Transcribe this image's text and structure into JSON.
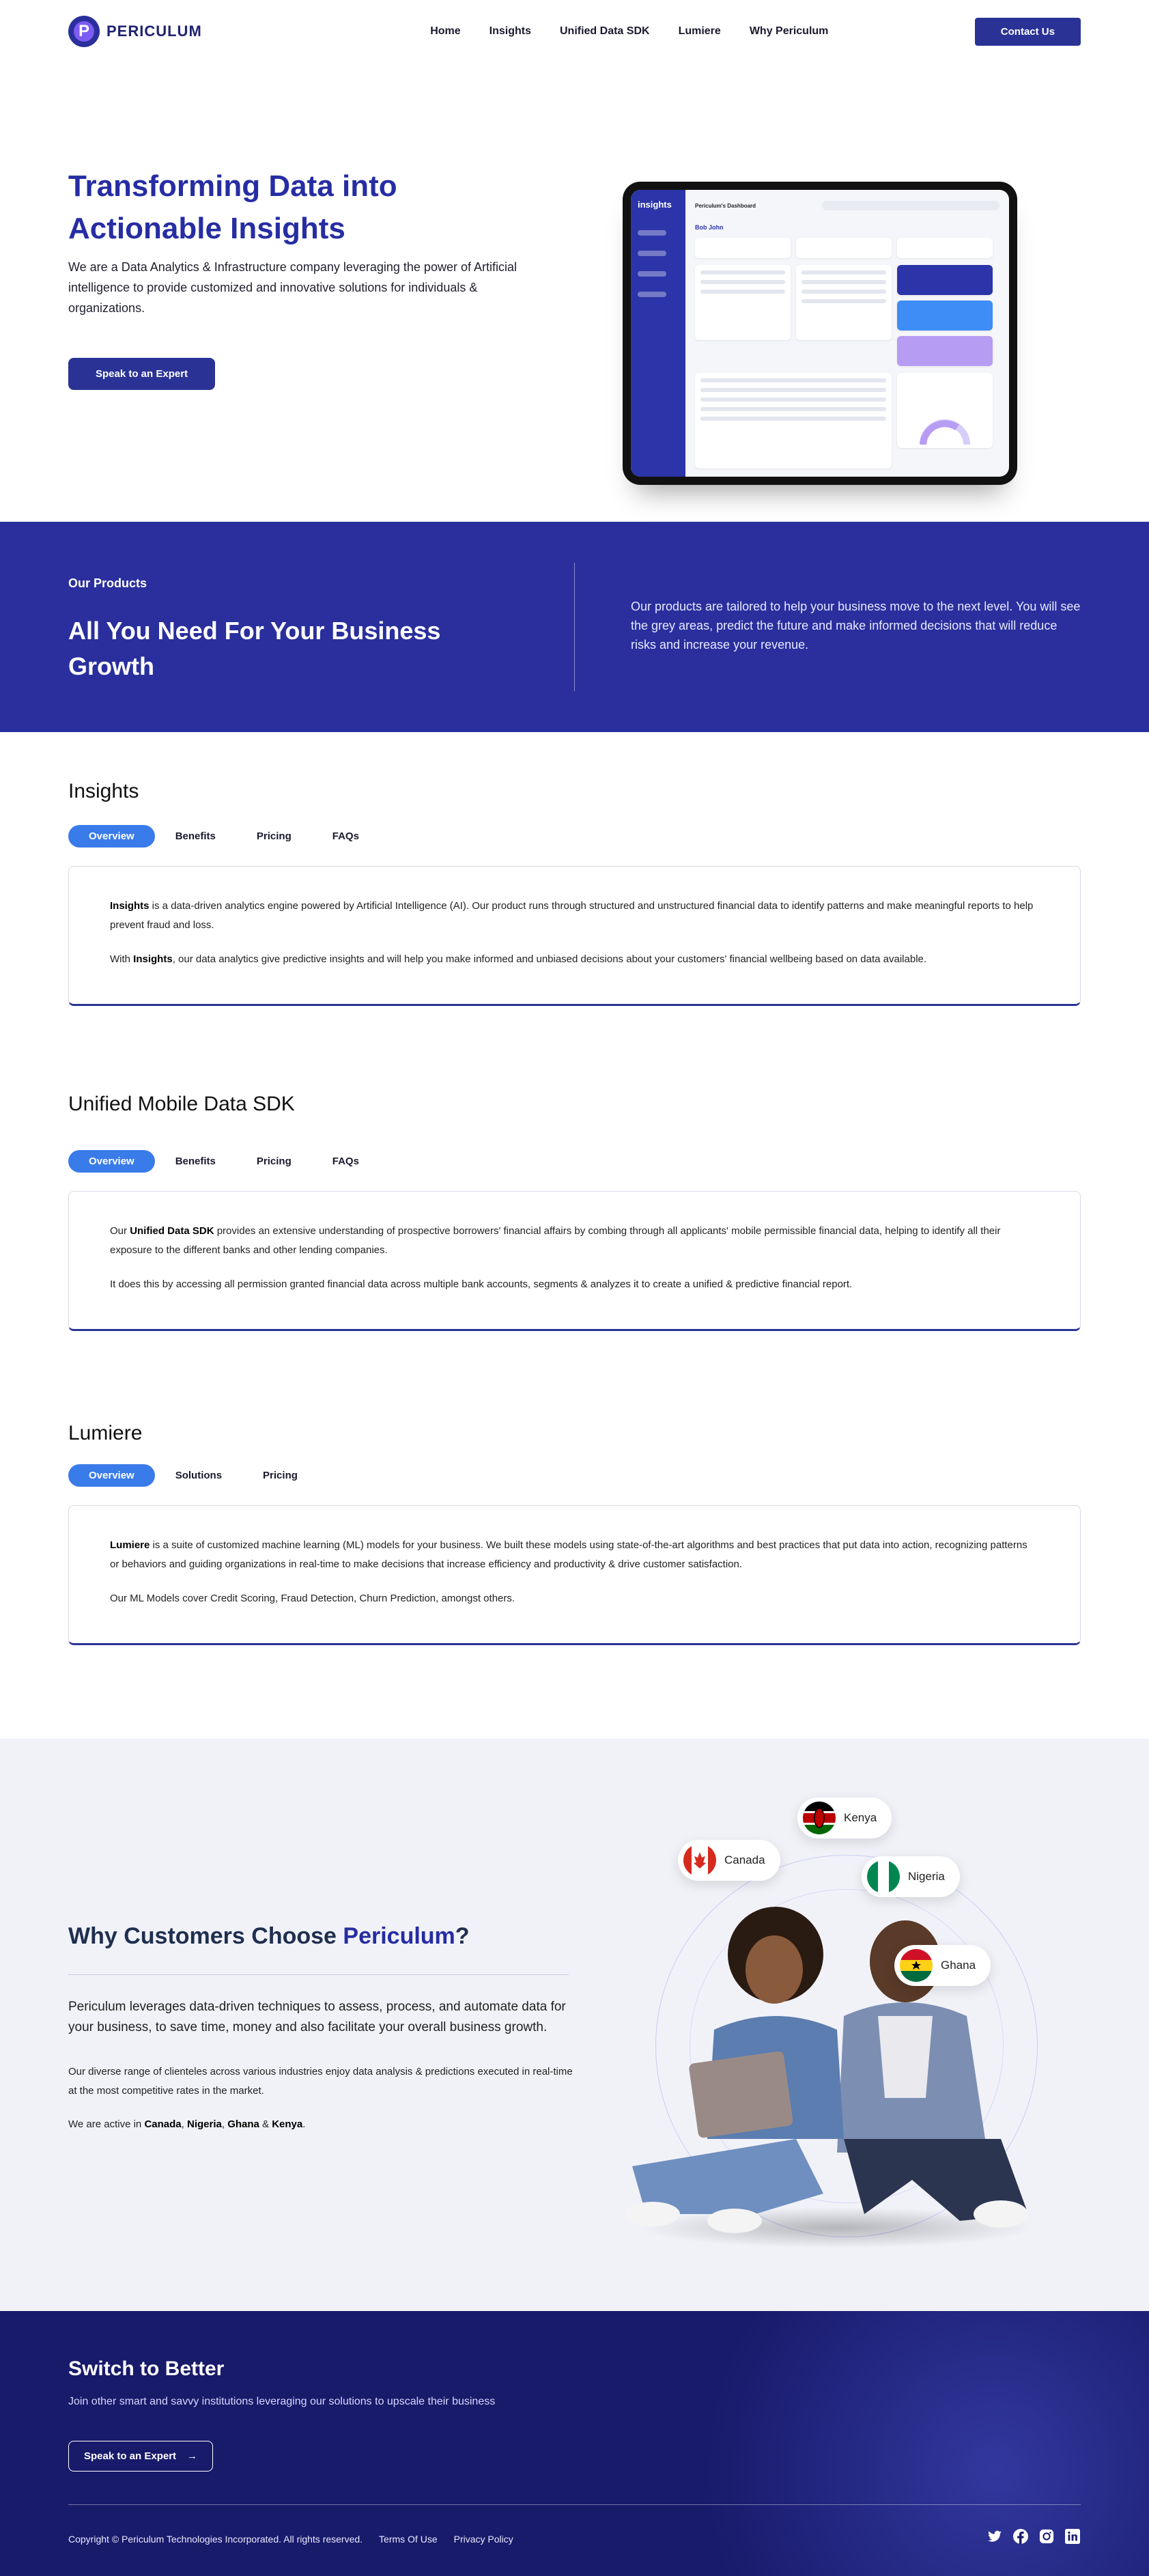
{
  "nav": {
    "logo_text": "PERICULUM",
    "links": [
      "Home",
      "Insights",
      "Unified Data SDK",
      "Lumiere",
      "Why Periculum"
    ],
    "contact_label": "Contact Us"
  },
  "hero": {
    "title": "Transforming Data into Actionable Insights",
    "subtitle": "We are a Data Analytics & Infrastructure company leveraging the power of Artificial intelligence to provide customized and innovative solutions for individuals & organizations.",
    "cta": "Speak to an Expert",
    "tablet": {
      "brand": "insights",
      "dashboard_title": "Periculum's Dashboard",
      "greeting": "Bob John"
    }
  },
  "products": {
    "label": "Our Products",
    "title": "All You Need For Your Business Growth",
    "description": "Our products are tailored to help your business move to the next level. You will see the grey areas, predict the future and make informed decisions that will reduce risks and increase your revenue."
  },
  "insights": {
    "title": "Insights",
    "tabs": [
      "Overview",
      "Benefits",
      "Pricing",
      "FAQs"
    ],
    "p1_strong": "Insights",
    "p1_rest": " is a data-driven analytics engine powered by Artificial Intelligence (AI). Our product runs through structured and unstructured financial data to identify patterns and make meaningful reports to help prevent fraud and loss.",
    "p2_pre": "With ",
    "p2_strong": "Insights",
    "p2_rest": ", our data analytics give predictive insights and will help you make informed and unbiased decisions about your customers' financial wellbeing based on data available."
  },
  "sdk": {
    "title": "Unified Mobile Data SDK",
    "tabs": [
      "Overview",
      "Benefits",
      "Pricing",
      "FAQs"
    ],
    "p1_pre": "Our ",
    "p1_strong": "Unified Data SDK",
    "p1_rest": " provides an extensive understanding of prospective borrowers' financial affairs by combing through all applicants' mobile permissible financial data, helping to identify all their exposure to the different banks and other lending companies.",
    "p2": "It does this by accessing all permission granted financial data across multiple bank accounts, segments & analyzes it to create a unified & predictive financial report."
  },
  "lumiere": {
    "title": "Lumiere",
    "tabs": [
      "Overview",
      "Solutions",
      "Pricing"
    ],
    "p1_strong": "Lumiere",
    "p1_rest": " is a suite of customized machine learning (ML) models for your business. We built these models using state-of-the-art algorithms and best practices that put data into action, recognizing patterns or behaviors and guiding organizations in real-time to make decisions that increase efficiency and productivity & drive customer satisfaction.",
    "p2": "Our ML Models cover Credit Scoring, Fraud Detection, Churn Prediction, amongst others."
  },
  "why": {
    "title_pre": "Why Customers Choose ",
    "title_accent": "Periculum",
    "title_post": "?",
    "p1": "Periculum leverages data-driven techniques to assess, process, and automate data for your business, to save time, money and also facilitate your overall business growth.",
    "p2": "Our diverse range of clienteles across various industries enjoy data analysis & predictions executed in real-time at the most competitive rates in the market.",
    "p3_pre": "We are active in ",
    "countries": [
      "Canada",
      "Nigeria",
      "Ghana",
      "Kenya"
    ],
    "sep1": ", ",
    "sep2": ", ",
    "sep3": " & ",
    "p3_end": "."
  },
  "footer": {
    "title": "Switch to Better",
    "subtitle": "Join other smart and savvy institutions leveraging our solutions to upscale their business",
    "cta": "Speak to an Expert",
    "copyright": "Copyright © Periculum Technologies Incorporated. All rights reserved.",
    "terms": "Terms Of Use",
    "privacy": "Privacy Policy",
    "social_icons": [
      "twitter-icon",
      "facebook-icon",
      "instagram-icon",
      "linkedin-icon"
    ]
  },
  "colors": {
    "brand": "#2a3395",
    "accent_tab": "#3a7bea",
    "products_bg": "#2a2f9d",
    "footer_bg": "#181a6a"
  }
}
